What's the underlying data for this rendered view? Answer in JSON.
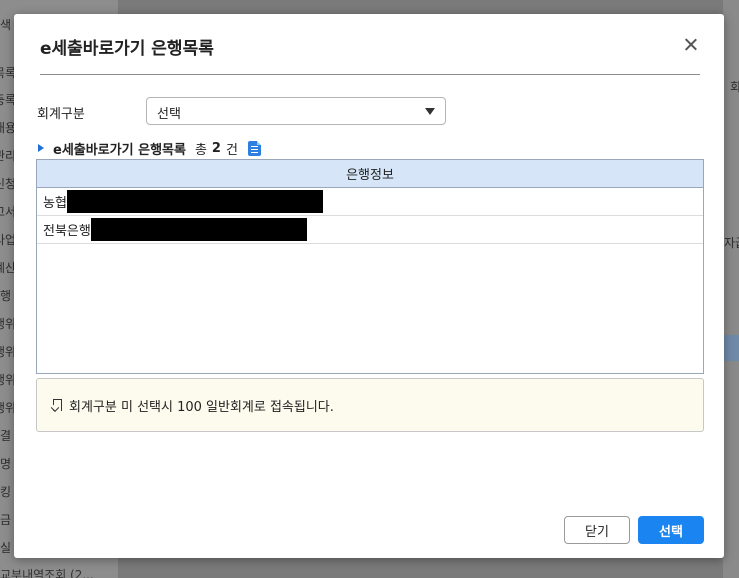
{
  "background": {
    "left_labels": [
      "색",
      "목록",
      "등록",
      "내용",
      "관리",
      "신청",
      "고서",
      "사업",
      "계산",
      "행",
      "행위",
      "행위",
      "행위",
      "행위",
      "결",
      "명",
      "킹",
      "금",
      "실"
    ],
    "right_labels": [
      "회",
      "자급"
    ],
    "bottom_label": "교부내역조회 (2..."
  },
  "modal": {
    "title": "e세출바로가기 은행목록",
    "close_icon": "close-icon",
    "account_type": {
      "label": "회계구분",
      "value": "선택"
    },
    "section": {
      "title": "e세출바로가기 은행목록",
      "count_prefix": "총",
      "count": "2",
      "count_suffix": "건",
      "export_icon": "excel-export-icon"
    },
    "grid": {
      "column_header": "은행정보",
      "rows": [
        {
          "bank": "농협",
          "redacted": true
        },
        {
          "bank": "전북은행",
          "redacted": true
        }
      ]
    },
    "notice": {
      "icon": "bookmark-icon",
      "text": "회계구분 미 선택시 100 일반회계로 접속됩니다."
    },
    "buttons": {
      "close_label": "닫기",
      "select_label": "선택"
    },
    "colors": {
      "primary": "#1a85f0",
      "grid_header": "#d6e6f8",
      "notice_bg": "#fdfbee"
    }
  }
}
